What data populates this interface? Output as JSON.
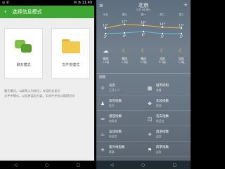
{
  "left": {
    "status": {
      "left": "◎ ✆",
      "right": "✉ ◔ 11:49"
    },
    "header": {
      "back": "‹",
      "title": "选择信息模式"
    },
    "cards": [
      {
        "label": "聊天模式"
      },
      {
        "label": "文件夹模式"
      }
    ],
    "desc": [
      "聊天模式，以联系人为单位，对话形式显示",
      "文件夹模式，以信息类型分类，如文件夹形式管理显示"
    ],
    "nav": [
      "◁",
      "○",
      "▢"
    ]
  },
  "right": {
    "menu": "≡",
    "city": "北京",
    "date": "三月 06 周六",
    "plus": "+",
    "days": [
      "今天",
      "周日",
      "周一",
      "周二",
      "周三"
    ],
    "temps_high": [
      "13°",
      "17°",
      "16°",
      "14°",
      "13°"
    ],
    "temps_low": [
      "3°",
      "4°",
      "6°",
      "3°",
      "3°"
    ],
    "forecast": [
      {
        "icon": "☁",
        "cloud": true,
        "wind": "微风",
        "level": "<3级"
      },
      {
        "icon": "☾",
        "cloud": false,
        "wind": "微风",
        "level": "<3级"
      },
      {
        "icon": "☾",
        "cloud": false,
        "wind": "微风",
        "level": "<3级"
      },
      {
        "icon": "☾",
        "cloud": false,
        "wind": "北风",
        "level": "4-5级"
      },
      {
        "icon": "☾",
        "cloud": false,
        "wind": "北风",
        "level": "<3级"
      }
    ],
    "index_title": "指数",
    "indices": [
      {
        "icon": "☼",
        "name": "农历",
        "value": "正月十六"
      },
      {
        "icon": "▦",
        "name": "城市四科",
        "value": "查看"
      },
      {
        "icon": "♟",
        "name": "穿衣指数",
        "value": "较冷"
      },
      {
        "icon": "❖",
        "name": "化妆指数",
        "value": "保湿"
      },
      {
        "icon": "♒",
        "name": "感冒指数",
        "value": "较易发"
      },
      {
        "icon": "◫",
        "name": "洗车指数",
        "value": "较适宜"
      },
      {
        "icon": "♨",
        "name": "运动指数",
        "value": "较适宜"
      },
      {
        "icon": "✈",
        "name": "旅游指数",
        "value": "适宜"
      },
      {
        "icon": "☀",
        "name": "紫外线指数",
        "value": "最弱"
      },
      {
        "icon": "⚑",
        "name": "风筝指数",
        "value": "适宜"
      }
    ],
    "nav": [
      "◁",
      "○",
      "▢"
    ]
  }
}
